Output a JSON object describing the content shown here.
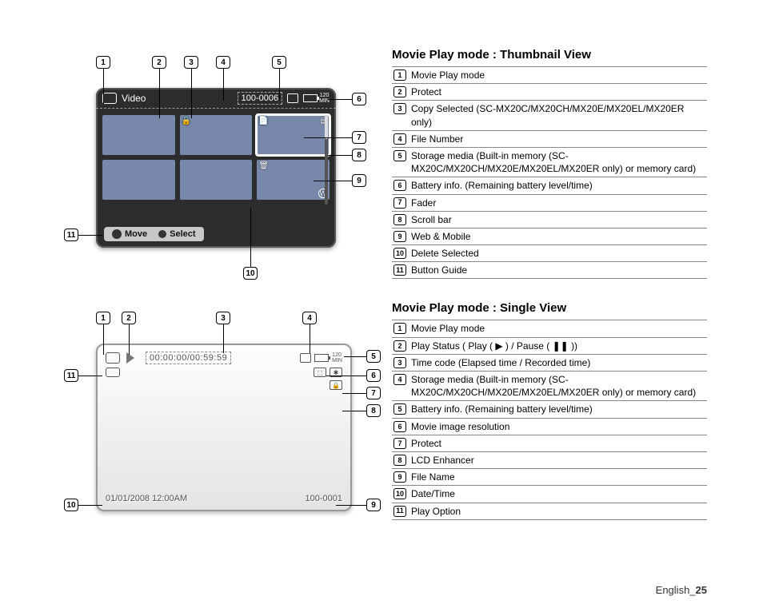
{
  "footer": {
    "lang": "English",
    "sep": "_",
    "page": "25"
  },
  "thumbnail": {
    "title": "Movie Play mode : Thumbnail View",
    "lcd": {
      "mode_label": "Video",
      "file_number": "100-0006",
      "battery_time": "120",
      "battery_unit": "MIN",
      "move_label": "Move",
      "select_label": "Select"
    },
    "legend": [
      "Movie Play mode",
      "Protect",
      "Copy Selected (SC-MX20C/MX20CH/MX20E/MX20EL/MX20ER only)",
      "File Number",
      "Storage media (Built-in memory (SC-MX20C/MX20CH/MX20E/MX20EL/MX20ER only) or memory card)",
      "Battery info. (Remaining battery level/time)",
      "Fader",
      "Scroll bar",
      "Web & Mobile",
      "Delete Selected",
      "Button Guide"
    ]
  },
  "single": {
    "title": "Movie Play mode : Single View",
    "lcd": {
      "timecode": "00:00:00/00:59:59",
      "datetime": "01/01/2008  12:00AM",
      "filename": "100-0001",
      "battery_time": "120",
      "battery_unit": "MIN"
    },
    "legend": [
      "Movie Play mode",
      "Play Status ( Play ( ▶ ) / Pause ( ❚❚ ))",
      "Time code (Elapsed time / Recorded time)",
      "Storage media (Built-in memory (SC-MX20C/MX20CH/MX20E/MX20EL/MX20ER only) or memory card)",
      "Battery info. (Remaining battery level/time)",
      "Movie image resolution",
      "Protect",
      "LCD Enhancer",
      "File Name",
      "Date/Time",
      "Play Option"
    ]
  },
  "nums": [
    "1",
    "2",
    "3",
    "4",
    "5",
    "6",
    "7",
    "8",
    "9",
    "10",
    "11"
  ]
}
